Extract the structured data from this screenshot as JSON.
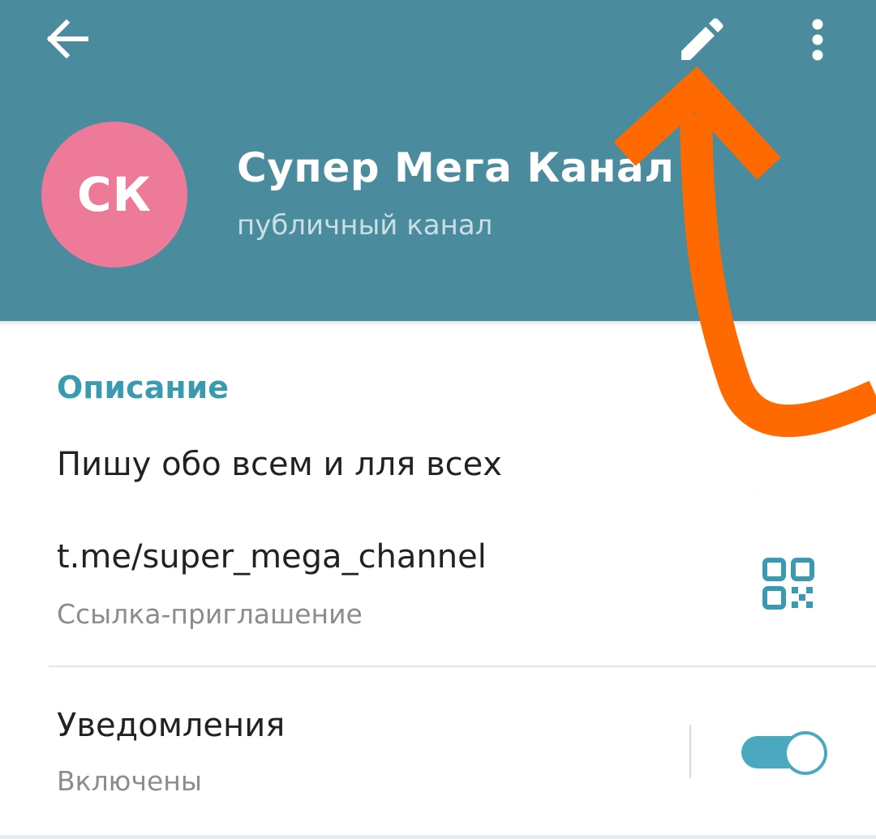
{
  "app": {
    "accent": "#4a8b9d",
    "link_accent": "#3a9bb0",
    "annotation_color": "#ff6a00"
  },
  "header": {
    "back_icon": "arrow-left-icon",
    "edit_icon": "pencil-icon",
    "more_icon": "more-vert-icon",
    "avatar": {
      "initials": "СК",
      "color": "#ee7a9a"
    },
    "channel_name": "Супер Мега Канал",
    "channel_type": "публичный канал"
  },
  "info": {
    "description_title": "Описание",
    "description": "Пишу обо всем и лля всех",
    "link": {
      "url": "t.me/super_mega_channel",
      "label": "Ссылка-приглашение",
      "qr_icon": "qr-code-icon"
    },
    "notifications": {
      "title": "Уведомления",
      "status": "Включены",
      "enabled": true
    }
  }
}
